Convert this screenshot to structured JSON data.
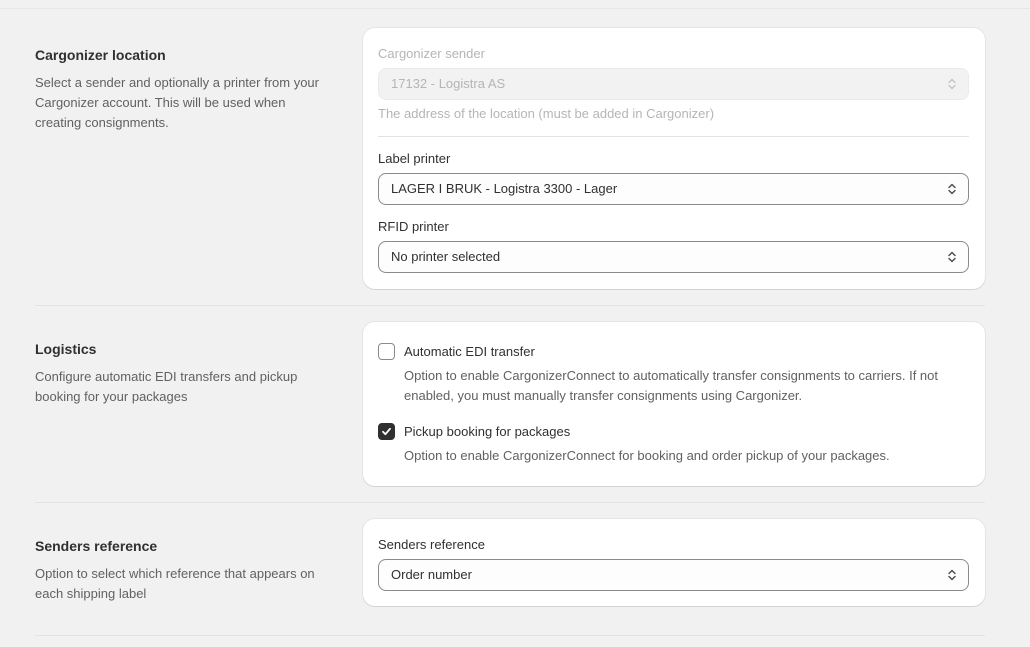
{
  "location": {
    "title": "Cargonizer location",
    "description": "Select a sender and optionally a printer from your Cargonizer account. This will be used when creating consignments.",
    "sender_label": "Cargonizer sender",
    "sender_value": "17132 - Logistra AS",
    "sender_help": "The address of the location (must be added in Cargonizer)",
    "label_printer_label": "Label printer",
    "label_printer_value": "LAGER I BRUK - Logistra 3300 - Lager",
    "rfid_printer_label": "RFID printer",
    "rfid_printer_value": "No printer selected"
  },
  "logistics": {
    "title": "Logistics",
    "description": "Configure automatic EDI transfers and pickup booking for your packages",
    "edi_label": "Automatic EDI transfer",
    "edi_checked": false,
    "edi_description": "Option to enable CargonizerConnect to automatically transfer consignments to carriers. If not enabled, you must manually transfer consignments using Cargonizer.",
    "pickup_label": "Pickup booking for packages",
    "pickup_checked": true,
    "pickup_description": "Option to enable CargonizerConnect for booking and order pickup of your packages."
  },
  "senders_reference": {
    "title": "Senders reference",
    "description": "Option to select which reference that appears on each shipping label",
    "field_label": "Senders reference",
    "field_value": "Order number"
  },
  "icons": {
    "select": "chevron-up-down-icon",
    "checkbox_checked": "checkmark-icon"
  }
}
